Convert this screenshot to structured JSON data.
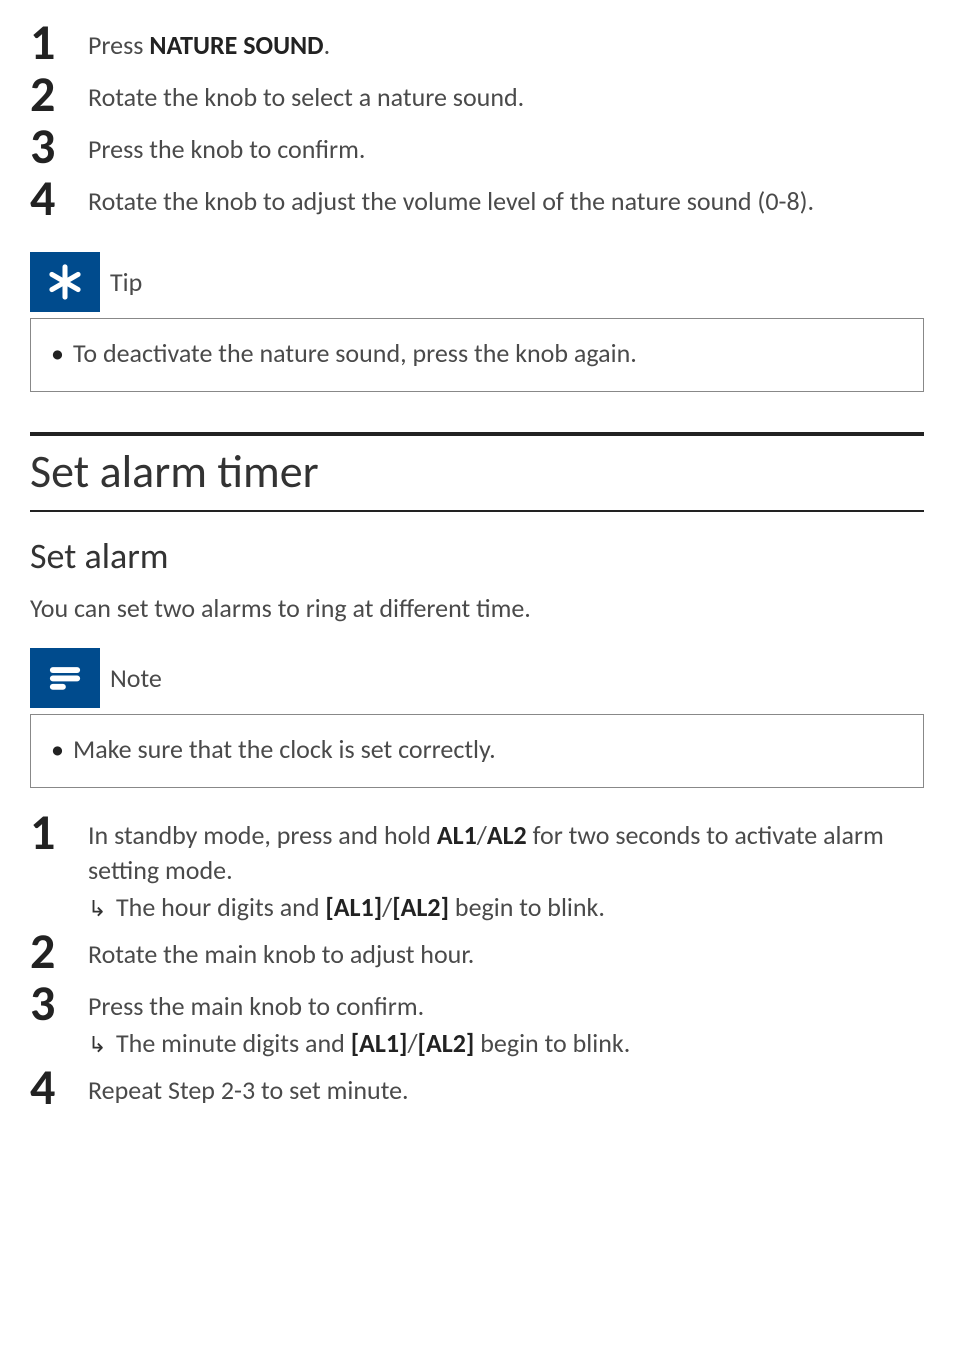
{
  "nature_steps": [
    {
      "num": "1",
      "prefix": "Press ",
      "bold": "NATURE SOUND",
      "suffix": "."
    },
    {
      "num": "2",
      "text": "Rotate the knob to select a nature sound."
    },
    {
      "num": "3",
      "text": "Press the knob to confirm."
    },
    {
      "num": "4",
      "text": "Rotate the knob to adjust the volume level of the nature sound (0-8)."
    }
  ],
  "tip": {
    "label": "Tip",
    "items": [
      "To deactivate the nature sound, press the knob again."
    ]
  },
  "section": {
    "title": "Set alarm timer",
    "subtitle": "Set alarm",
    "intro": "You can set two alarms to ring at different time."
  },
  "note": {
    "label": "Note",
    "items": [
      "Make sure that the clock is set correctly."
    ]
  },
  "alarm_steps": {
    "s1": {
      "num": "1",
      "pre": "In standby mode, press and hold ",
      "b1": "AL1",
      "sep": "/",
      "b2": "AL2",
      "post": " for two seconds to activate alarm setting mode.",
      "sub_pre": "The hour digits and ",
      "sub_b1": "[AL1]",
      "sub_sep": "/",
      "sub_b2": "[AL2]",
      "sub_post": " begin to blink."
    },
    "s2": {
      "num": "2",
      "text": "Rotate the main knob to adjust hour."
    },
    "s3": {
      "num": "3",
      "text": "Press the main knob to confirm.",
      "sub_pre": "The minute digits and ",
      "sub_b1": "[AL1]",
      "sub_sep": "/",
      "sub_b2": "[AL2]",
      "sub_post": " begin to blink."
    },
    "s4": {
      "num": "4",
      "text": "Repeat Step 2-3 to set minute."
    }
  }
}
